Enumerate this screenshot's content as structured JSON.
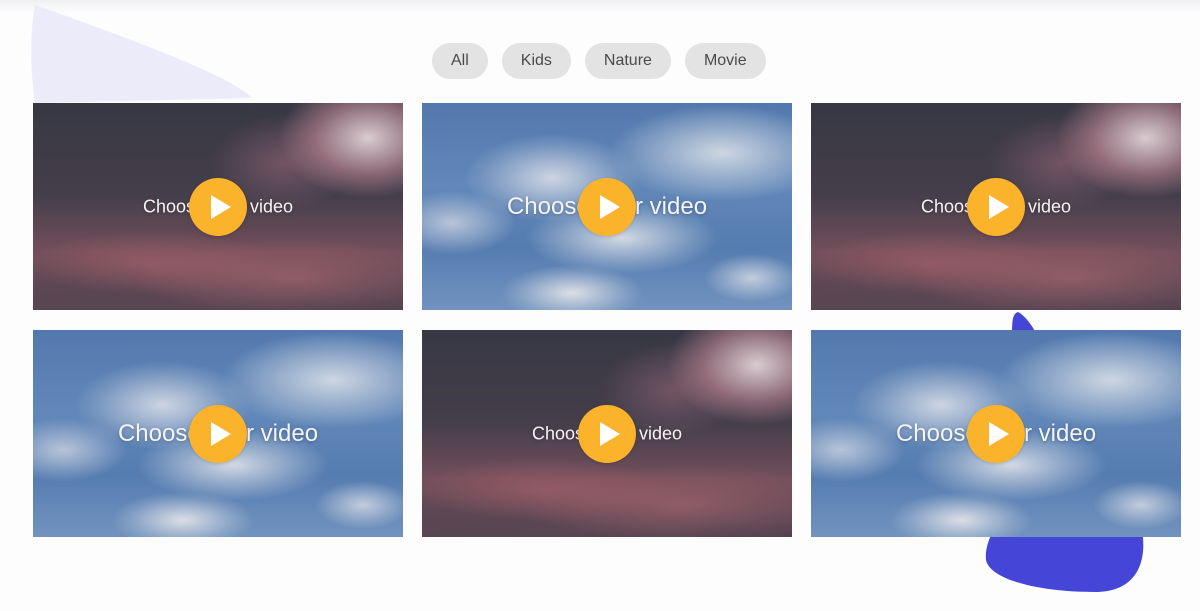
{
  "filters": [
    {
      "label": "All"
    },
    {
      "label": "Kids"
    },
    {
      "label": "Nature"
    },
    {
      "label": "Movie"
    }
  ],
  "videos": [
    {
      "title": "Choose your video",
      "scene": "sunset",
      "play_icon": "play-icon"
    },
    {
      "title": "Choose your video",
      "scene": "sky",
      "play_icon": "play-icon"
    },
    {
      "title": "Choose your video",
      "scene": "sunset",
      "play_icon": "play-icon"
    },
    {
      "title": "Choose your video",
      "scene": "sky",
      "play_icon": "play-icon"
    },
    {
      "title": "Choose your video",
      "scene": "sunset",
      "play_icon": "play-icon"
    },
    {
      "title": "Choose your video",
      "scene": "sky",
      "play_icon": "play-icon"
    }
  ],
  "colors": {
    "play_button": "#fbb32c",
    "filter_background": "#e3e3e3",
    "decor_lavender": "#ebebfa",
    "decor_indigo": "#4545d8"
  }
}
